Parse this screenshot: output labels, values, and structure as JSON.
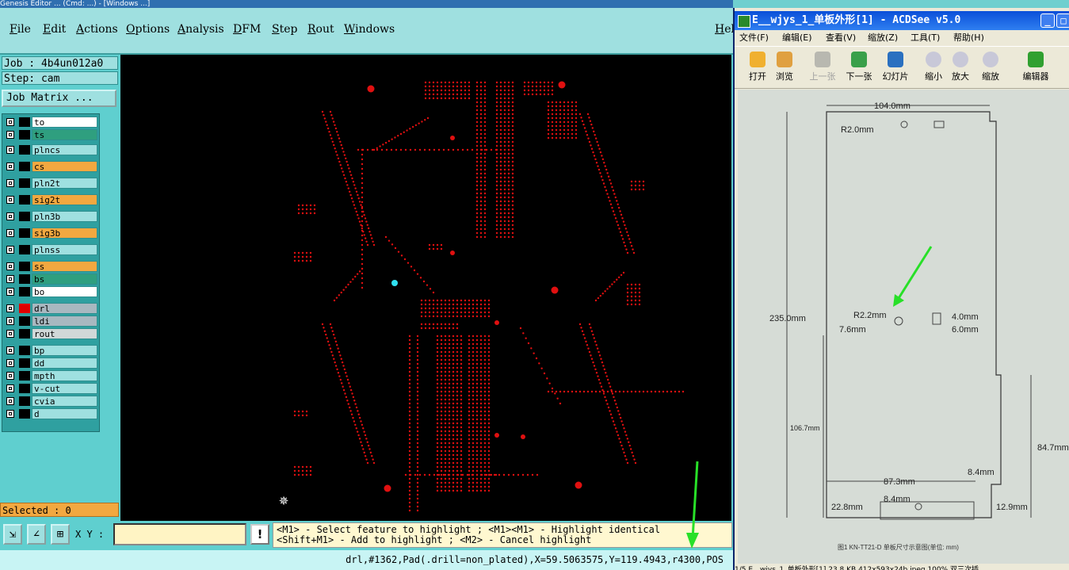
{
  "genesis": {
    "title": "Genesis Editor ... (Cmd: ...) - [Windows ...]",
    "menu": [
      "File",
      "Edit",
      "Actions",
      "Options",
      "Analysis",
      "DFM",
      "Step",
      "Rout",
      "Windows"
    ],
    "help": "Hel",
    "job_label": "Job : 4b4un012a0",
    "step_label": "Step: cam",
    "job_matrix_button": "Job Matrix ...",
    "layers": [
      {
        "name": "to",
        "color": "#ffffff",
        "sw": "#000000"
      },
      {
        "name": "ts",
        "color": "#2f9f7f",
        "sw": "#000000"
      },
      {
        "name": "plncs",
        "color": "#9fe0e0",
        "sw": "#000000"
      },
      {
        "name": "cs",
        "color": "#f2a840",
        "sw": "#000000"
      },
      {
        "name": "pln2t",
        "color": "#9fe0e0",
        "sw": "#000000"
      },
      {
        "name": "sig2t",
        "color": "#f2a840",
        "sw": "#000000"
      },
      {
        "name": "pln3b",
        "color": "#9fe0e0",
        "sw": "#000000"
      },
      {
        "name": "sig3b",
        "color": "#f2a840",
        "sw": "#000000"
      },
      {
        "name": "plnss",
        "color": "#9fe0e0",
        "sw": "#000000"
      },
      {
        "name": "ss",
        "color": "#f2a840",
        "sw": "#000000"
      },
      {
        "name": "bs",
        "color": "#2f9f7f",
        "sw": "#000000"
      },
      {
        "name": "bo",
        "color": "#ffffff",
        "sw": "#000000"
      },
      {
        "name": "drl",
        "color": "#a8b8c0",
        "sw": "#e00000"
      },
      {
        "name": "ldi",
        "color": "#a8b8c0",
        "sw": "#000000"
      },
      {
        "name": "rout",
        "color": "#d0d8d8",
        "sw": "#000000"
      },
      {
        "name": "bp",
        "color": "#9fe0e0",
        "sw": "#000000"
      },
      {
        "name": "dd",
        "color": "#9fe0e0",
        "sw": "#000000"
      },
      {
        "name": "mpth",
        "color": "#9fe0e0",
        "sw": "#000000"
      },
      {
        "name": "v-cut",
        "color": "#9fe0e0",
        "sw": "#000000"
      },
      {
        "name": "cvia",
        "color": "#9fe0e0",
        "sw": "#000000"
      },
      {
        "name": "d",
        "color": "#9fe0e0",
        "sw": "#000000"
      }
    ],
    "selected": "Selected : 0",
    "xy_label": "X Y :",
    "xy_value": "",
    "warn": "!",
    "msg_line1": "<M1> - Select feature to highlight ; <M1><M1> - Highlight identical",
    "msg_line2": "<Shift+M1> - Add to highlight ; <M2> - Cancel highlight",
    "status": "drl,#1362,Pad(.drill=non_plated),X=59.5063575,Y=119.4943,r4300,POS"
  },
  "acdsee": {
    "title": "E__wjys_1_单板外形[1] - ACDSee v5.0",
    "menu": [
      "文件(F)",
      "编辑(E)",
      "查看(V)",
      "缩放(Z)",
      "工具(T)",
      "帮助(H)"
    ],
    "toolbar": [
      "打开",
      "浏览",
      "上一张",
      "下一张",
      "幻灯片",
      "缩小",
      "放大",
      "缩放",
      "编辑器"
    ],
    "status": "1/5   E__wjys_1_单板外形[1]   23.8 KB   412x593x24b jpeg   100%   双三次插",
    "drawing": {
      "width_dim": "104.0mm",
      "r2": "R2.0mm",
      "height_dim": "235.0mm",
      "r22": "R2.2mm",
      "d76": "7.6mm",
      "d40": "4.0mm",
      "d60": "6.0mm",
      "d1067": "106.7mm",
      "d847": "84.7mm",
      "d873": "87.3mm",
      "d84a": "8.4mm",
      "d84b": "8.4mm",
      "d228": "22.8mm",
      "d129": "12.9mm",
      "caption": "图1  KN-TT21-D 单板尺寸示意图(单位: mm)"
    }
  }
}
